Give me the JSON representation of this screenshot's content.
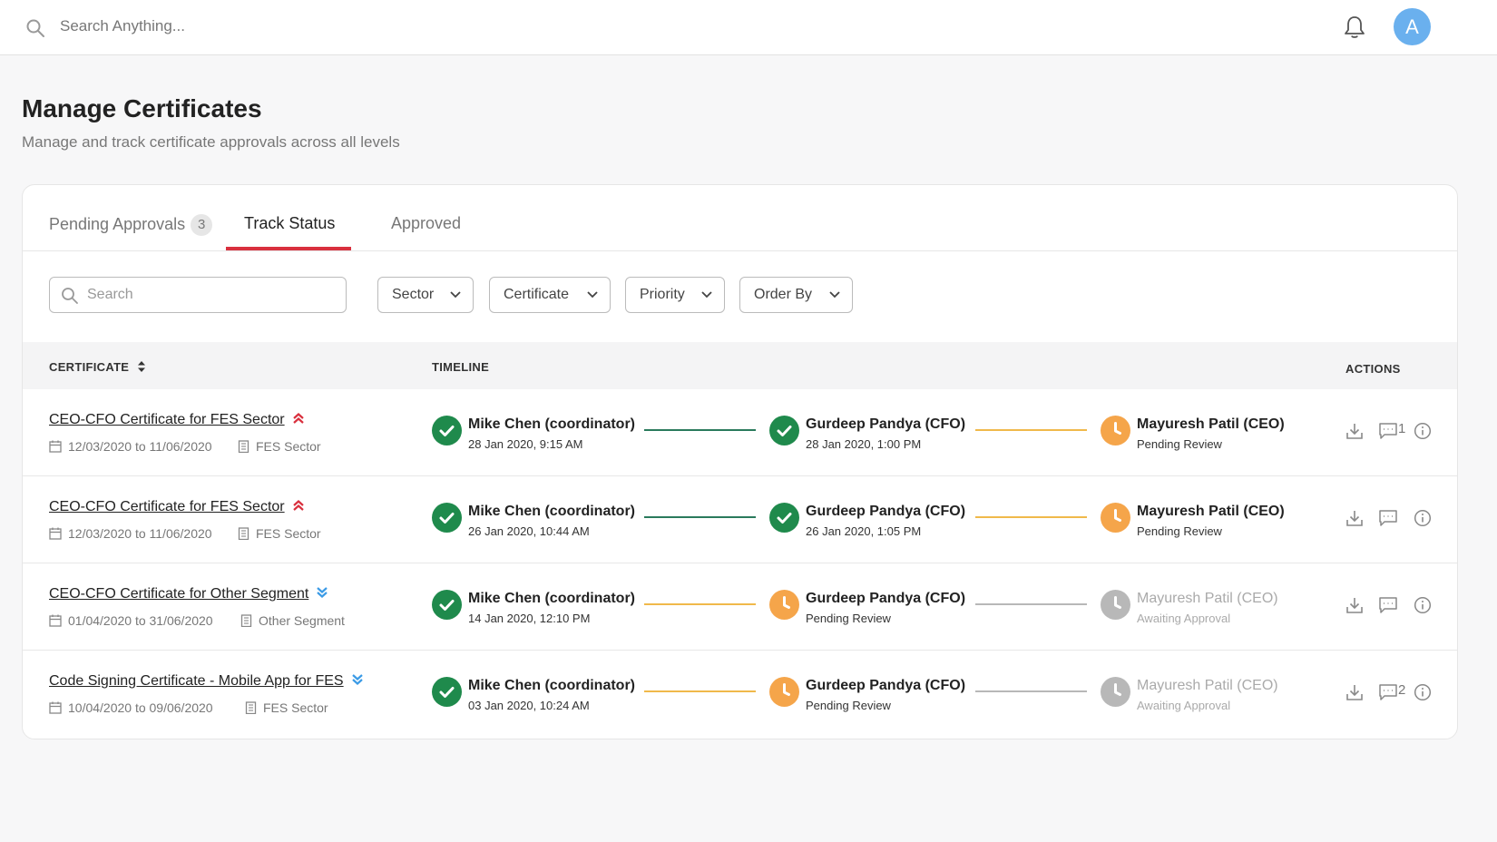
{
  "topbar": {
    "search_placeholder": "Search Anything...",
    "avatar_initial": "A"
  },
  "page": {
    "title": "Manage Certificates",
    "subtitle": "Manage and track certificate approvals across all levels"
  },
  "tabs": [
    {
      "label": "Pending Approvals",
      "badge": "3",
      "active": false
    },
    {
      "label": "Track Status",
      "active": true
    },
    {
      "label": "Approved",
      "active": false
    }
  ],
  "filters": {
    "search_placeholder": "Search",
    "sector": "Sector",
    "certificate": "Certificate",
    "priority": "Priority",
    "order_by": "Order By"
  },
  "table": {
    "col_certificate": "CERTIFICATE",
    "col_timeline": "TIMELINE",
    "col_actions": "ACTIONS"
  },
  "rows": [
    {
      "title": "CEO-CFO Certificate for FES Sector",
      "priority": "high",
      "dates": "12/03/2020 to 11/06/2020",
      "sector": "FES Sector",
      "stages": [
        {
          "name": "Mike Chen (coordinator)",
          "sub": "28 Jan 2020, 9:15 AM",
          "status": "done"
        },
        {
          "name": "Gurdeep Pandya (CFO)",
          "sub": "28 Jan 2020, 1:00 PM",
          "status": "done"
        },
        {
          "name": "Mayuresh Patil (CEO)",
          "sub": "Pending Review",
          "status": "pending"
        }
      ],
      "connectors": [
        "green",
        "orange"
      ],
      "comments": "1"
    },
    {
      "title": "CEO-CFO Certificate for FES Sector",
      "priority": "high",
      "dates": "12/03/2020 to 11/06/2020",
      "sector": "FES Sector",
      "stages": [
        {
          "name": "Mike Chen (coordinator)",
          "sub": "26 Jan 2020, 10:44 AM",
          "status": "done"
        },
        {
          "name": "Gurdeep Pandya (CFO)",
          "sub": "26 Jan 2020, 1:05 PM",
          "status": "done"
        },
        {
          "name": "Mayuresh Patil (CEO)",
          "sub": "Pending Review",
          "status": "pending"
        }
      ],
      "connectors": [
        "green",
        "orange"
      ],
      "comments": ""
    },
    {
      "title": "CEO-CFO Certificate for Other Segment",
      "priority": "low",
      "dates": "01/04/2020 to 31/06/2020",
      "sector": "Other Segment",
      "stages": [
        {
          "name": "Mike Chen (coordinator)",
          "sub": "14 Jan 2020, 12:10 PM",
          "status": "done"
        },
        {
          "name": "Gurdeep Pandya (CFO)",
          "sub": "Pending Review",
          "status": "pending"
        },
        {
          "name": "Mayuresh Patil (CEO)",
          "sub": "Awaiting Approval",
          "status": "waiting"
        }
      ],
      "connectors": [
        "orange",
        "grey"
      ],
      "comments": ""
    },
    {
      "title": "Code Signing Certificate - Mobile App for FES",
      "priority": "low",
      "dates": "10/04/2020 to 09/06/2020",
      "sector": "FES Sector",
      "stages": [
        {
          "name": "Mike Chen (coordinator)",
          "sub": "03 Jan 2020, 10:24 AM",
          "status": "done"
        },
        {
          "name": "Gurdeep Pandya (CFO)",
          "sub": "Pending Review",
          "status": "pending"
        },
        {
          "name": "Mayuresh Patil (CEO)",
          "sub": "Awaiting Approval",
          "status": "waiting"
        }
      ],
      "connectors": [
        "orange",
        "grey"
      ],
      "comments": "2"
    }
  ],
  "colors": {
    "accent_red": "#d9303e",
    "done_green": "#1f8a4c",
    "pending_orange": "#f5a54a",
    "waiting_grey": "#b8b8b8",
    "avatar_blue": "#6ab0ee",
    "priority_low_blue": "#3b9be6"
  },
  "icons": {
    "search": "search-icon",
    "bell": "bell-icon",
    "check": "check-icon",
    "clock": "clock-icon",
    "calendar": "calendar-icon",
    "building": "building-icon",
    "download": "download-icon",
    "comment": "comment-icon",
    "info": "info-icon",
    "high_priority": "double-chevron-up-icon",
    "low_priority": "double-chevron-down-icon",
    "sort": "sort-icon",
    "dropdown": "chevron-down-icon"
  }
}
